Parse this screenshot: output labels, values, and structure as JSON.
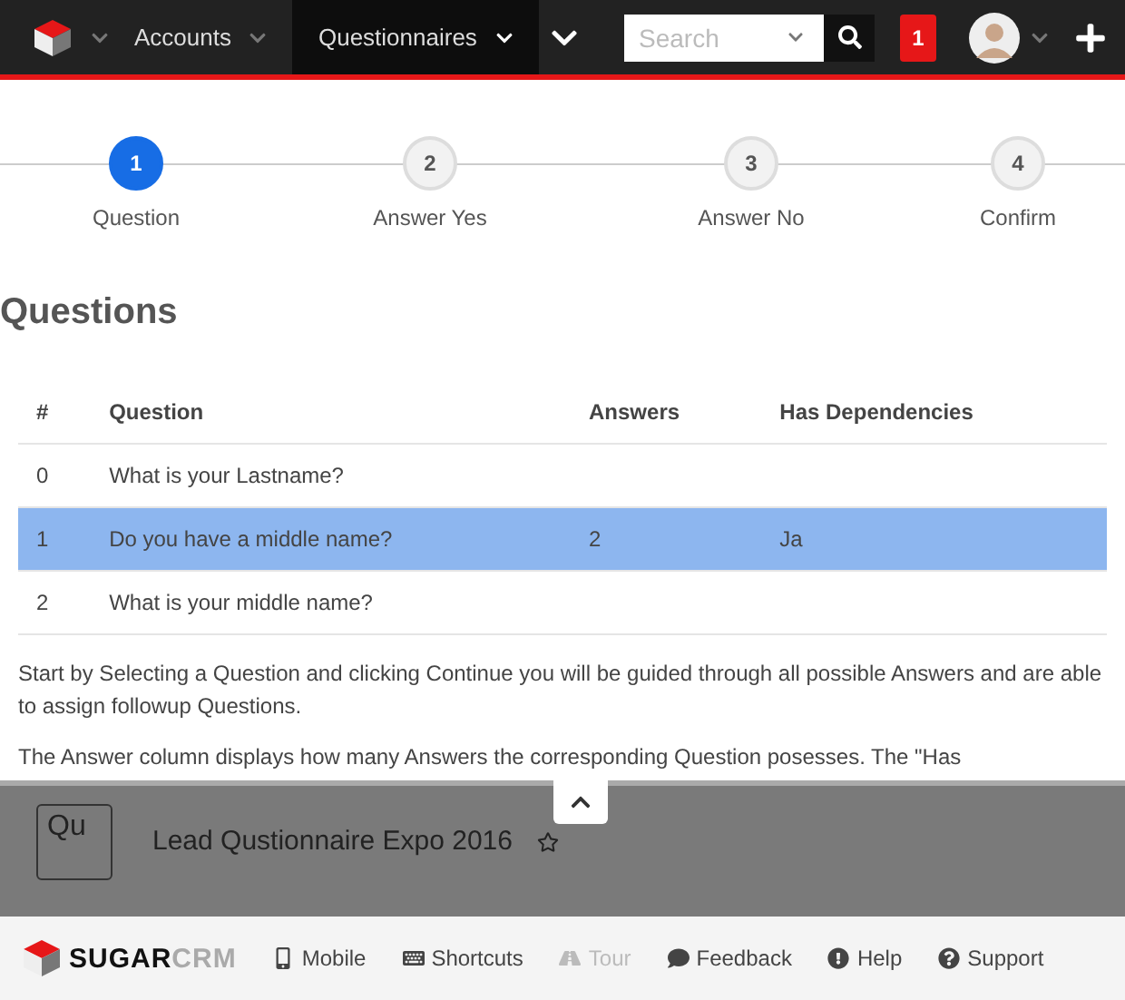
{
  "nav": {
    "modules": [
      {
        "label": "Accounts",
        "selected": false
      },
      {
        "label": "Questionnaires",
        "selected": true
      }
    ],
    "search": {
      "placeholder": "Search"
    },
    "notifications": "1"
  },
  "steps": [
    {
      "number": "1",
      "label": "Question",
      "selected": true
    },
    {
      "number": "2",
      "label": "Answer Yes",
      "selected": false
    },
    {
      "number": "3",
      "label": "Answer No",
      "selected": false
    },
    {
      "number": "4",
      "label": "Confirm",
      "selected": false
    }
  ],
  "heading": "Questions",
  "table": {
    "columns": [
      "#",
      "Question",
      "Answers",
      "Has Dependencies"
    ],
    "rows": [
      {
        "cells": [
          "0",
          "What is your Lastname?",
          "",
          ""
        ],
        "selected": false
      },
      {
        "cells": [
          "1",
          "Do you have a middle name?",
          "2",
          "Ja"
        ],
        "selected": true
      },
      {
        "cells": [
          "2",
          "What is your middle name?",
          "",
          ""
        ],
        "selected": false
      }
    ]
  },
  "paragraphs": [
    "Start by Selecting a Question and clicking Continue you will be guided through all possible Answers and are able to assign followup Questions.",
    "The Answer column displays how many Answers the corresponding Question posesses. The \"Has"
  ],
  "record": {
    "badge": "Qu",
    "title": "Lead Qustionnaire Expo 2016",
    "favorite": false
  },
  "footer": {
    "brand": [
      "SUGAR",
      "CRM"
    ],
    "links": [
      {
        "kind": "mobile",
        "label": "Mobile",
        "disabled": false
      },
      {
        "kind": "shortcuts",
        "label": "Shortcuts",
        "disabled": false
      },
      {
        "kind": "tour",
        "label": "Tour",
        "disabled": true
      },
      {
        "kind": "feedback",
        "label": "Feedback",
        "disabled": false
      },
      {
        "kind": "help",
        "label": "Help",
        "disabled": false
      },
      {
        "kind": "support",
        "label": "Support",
        "disabled": false
      }
    ]
  }
}
